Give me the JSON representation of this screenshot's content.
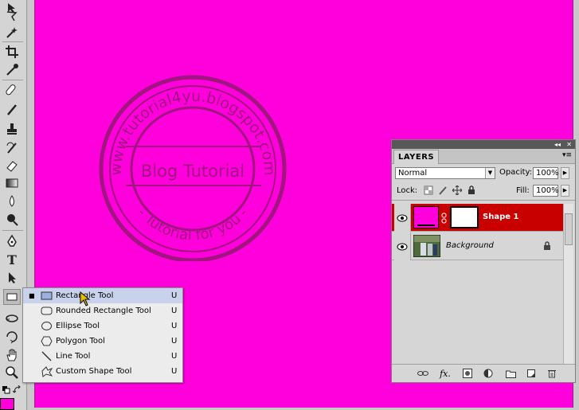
{
  "flyout": {
    "items": [
      {
        "label": "Rectangle Tool",
        "shortcut": "U",
        "selected": true,
        "icon": "rectangle-icon"
      },
      {
        "label": "Rounded Rectangle Tool",
        "shortcut": "U",
        "icon": "rounded-rectangle-icon"
      },
      {
        "label": "Ellipse Tool",
        "shortcut": "U",
        "icon": "ellipse-icon"
      },
      {
        "label": "Polygon Tool",
        "shortcut": "U",
        "icon": "polygon-icon"
      },
      {
        "label": "Line Tool",
        "shortcut": "U",
        "icon": "line-icon"
      },
      {
        "label": "Custom Shape Tool",
        "shortcut": "U",
        "icon": "custom-shape-icon"
      }
    ],
    "selected_marker": "■"
  },
  "watermark": {
    "outer_text": "www.tutorial4yu.blogspot.com",
    "center_text": "Blog Tutorial",
    "bottom_text": "- Tutorial for you -"
  },
  "layers_panel": {
    "tab": "LAYERS",
    "blend_mode": "Normal",
    "opacity_label": "Opacity:",
    "opacity": "100%",
    "lock_label": "Lock:",
    "fill_label": "Fill:",
    "fill": "100%",
    "layers": [
      {
        "name": "Shape 1",
        "selected": true,
        "visible": true
      },
      {
        "name": "Background",
        "selected": false,
        "visible": true,
        "locked": true
      }
    ]
  },
  "colors": {
    "canvas": "#ff00dd",
    "selected_layer": "#c80000",
    "flyout_highlight": "#c9d2ec"
  }
}
